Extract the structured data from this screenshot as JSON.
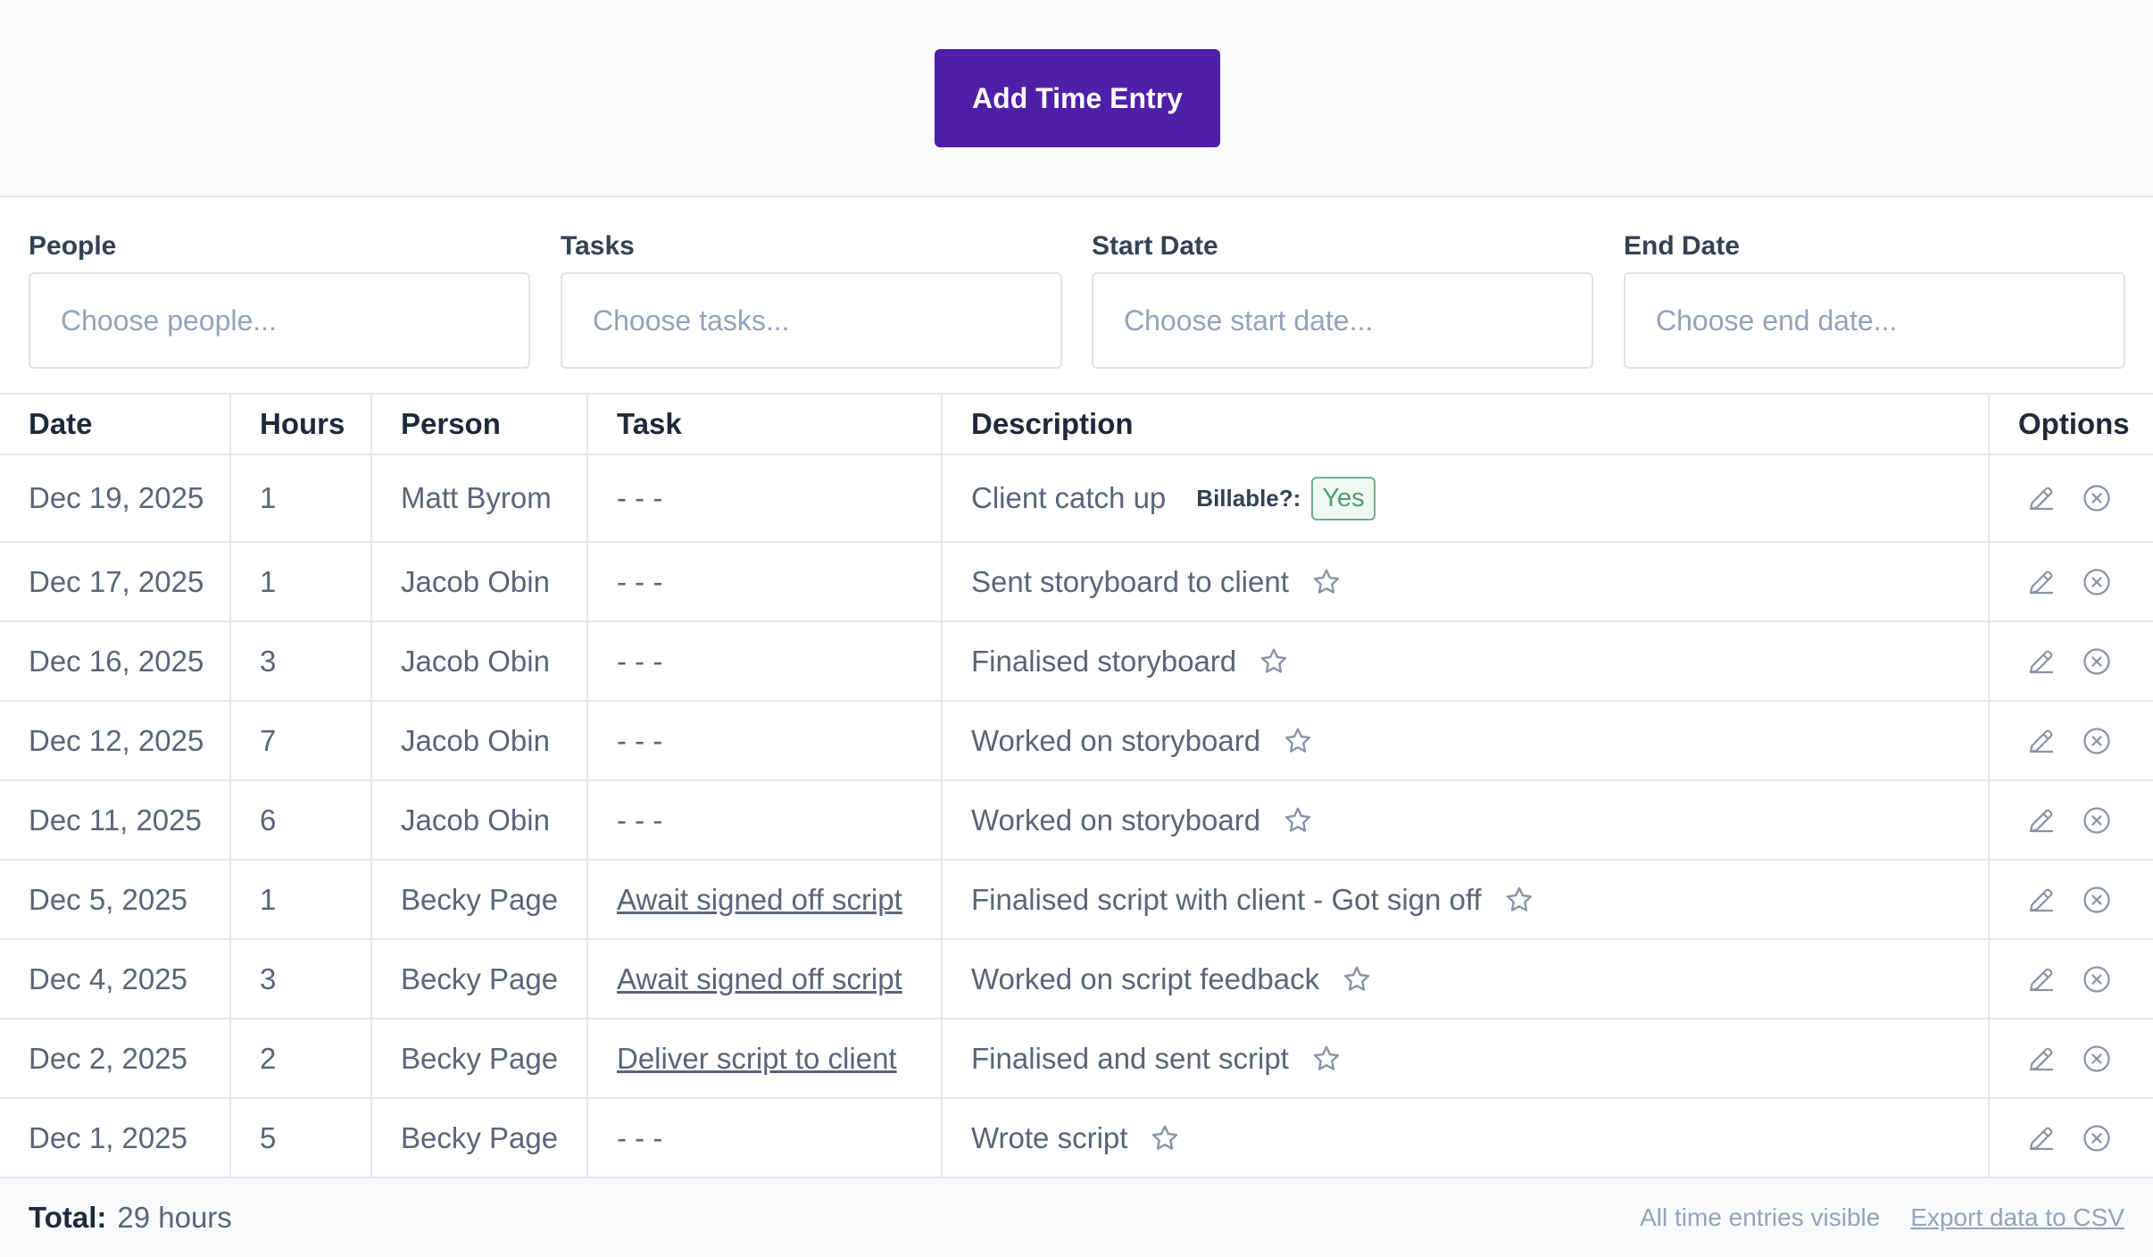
{
  "header": {
    "add_button_label": "Add Time Entry"
  },
  "filters": {
    "people": {
      "label": "People",
      "placeholder": "Choose people..."
    },
    "tasks": {
      "label": "Tasks",
      "placeholder": "Choose tasks..."
    },
    "start_date": {
      "label": "Start Date",
      "placeholder": "Choose start date..."
    },
    "end_date": {
      "label": "End Date",
      "placeholder": "Choose end date..."
    }
  },
  "table": {
    "columns": [
      "Date",
      "Hours",
      "Person",
      "Task",
      "Description",
      "Options"
    ],
    "billable_label": "Billable?:",
    "rows": [
      {
        "date": "Dec 19, 2025",
        "hours": "1",
        "person": "Matt Byrom",
        "task": "- - -",
        "task_link": false,
        "description": "Client catch up",
        "billable": "Yes"
      },
      {
        "date": "Dec 17, 2025",
        "hours": "1",
        "person": "Jacob Obin",
        "task": "- - -",
        "task_link": false,
        "description": "Sent storyboard to client"
      },
      {
        "date": "Dec 16, 2025",
        "hours": "3",
        "person": "Jacob Obin",
        "task": "- - -",
        "task_link": false,
        "description": "Finalised storyboard"
      },
      {
        "date": "Dec 12, 2025",
        "hours": "7",
        "person": "Jacob Obin",
        "task": "- - -",
        "task_link": false,
        "description": "Worked on storyboard"
      },
      {
        "date": "Dec 11, 2025",
        "hours": "6",
        "person": "Jacob Obin",
        "task": "- - -",
        "task_link": false,
        "description": "Worked on storyboard"
      },
      {
        "date": "Dec 5, 2025",
        "hours": "1",
        "person": "Becky Page",
        "task": "Await signed off script",
        "task_link": true,
        "description": "Finalised script with client - Got sign off"
      },
      {
        "date": "Dec 4, 2025",
        "hours": "3",
        "person": "Becky Page",
        "task": "Await signed off script",
        "task_link": true,
        "description": "Worked on script feedback"
      },
      {
        "date": "Dec 2, 2025",
        "hours": "2",
        "person": "Becky Page",
        "task": "Deliver script to client",
        "task_link": true,
        "description": "Finalised and sent script"
      },
      {
        "date": "Dec 1, 2025",
        "hours": "5",
        "person": "Becky Page",
        "task": "- - -",
        "task_link": false,
        "description": "Wrote script"
      }
    ]
  },
  "footer": {
    "total_label": "Total:",
    "total_value": "29 hours",
    "status": "All time entries visible",
    "export_label": "Export data to CSV"
  },
  "colors": {
    "accent": "#4f1fa8",
    "billable_green": "#4f9a7b"
  }
}
